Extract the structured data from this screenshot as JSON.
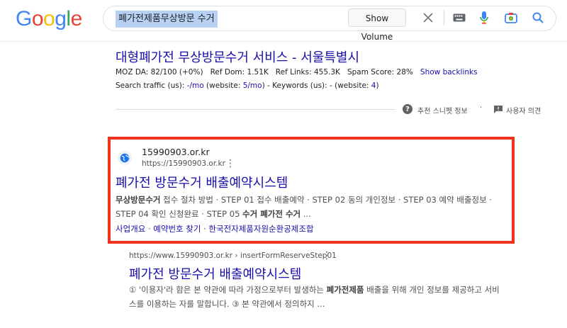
{
  "header": {
    "logo_letters": [
      {
        "ch": "G",
        "color": "#4285F4"
      },
      {
        "ch": "o",
        "color": "#EA4335"
      },
      {
        "ch": "o",
        "color": "#FBBC05"
      },
      {
        "ch": "g",
        "color": "#4285F4"
      },
      {
        "ch": "l",
        "color": "#34A853"
      },
      {
        "ch": "e",
        "color": "#EA4335"
      }
    ],
    "query": "폐가전제품무상방문 수거",
    "show_volume_label": "Show Volume",
    "icons": [
      "close-icon",
      "keyboard-icon",
      "mic-icon",
      "camera-icon",
      "search-icon"
    ]
  },
  "result1": {
    "title": "대형폐가전 무상방문수거 서비스 - 서울특별시",
    "moz_da": "MOZ DA: 82/100 (+0%)",
    "ref_dom": "Ref Dom: 1.51K",
    "ref_links": "Ref Links: 455.3K",
    "spam_score": "Spam Score: 28%",
    "show_backlinks": "Show backlinks",
    "traffic_prefix": "Search traffic (us): ",
    "traffic_value": "-/mo",
    "traffic_website_prefix": " (website: ",
    "traffic_website_value": "5/mo",
    "keywords_text": ") - Keywords (us): - (website: ",
    "keywords_value": "4",
    "keywords_suffix": ")"
  },
  "feedback": {
    "snippet_label": "추천 스니펫 정보",
    "separator": "·",
    "feedback_label": "사용자 의견"
  },
  "result2": {
    "site_name": "15990903.or.kr",
    "url": "https://15990903.or.kr",
    "title": "폐가전 방문수거 배출예약시스템",
    "snippet_line1": [
      {
        "t": "무상방문수거",
        "b": true
      },
      {
        "t": " 접수 절차 방법 · STEP 01 접수 배출예약 · STEP 02 동의 개인정보 · STEP 03 예약 배출정보 ·",
        "b": false
      }
    ],
    "snippet_line2": [
      {
        "t": "STEP 04 확인 신청완료 · STEP 05 ",
        "b": false
      },
      {
        "t": "수거 폐가전 수거",
        "b": true
      },
      {
        "t": " ...",
        "b": false
      }
    ],
    "sitelinks": [
      "사업개요",
      "예약번호 찾기",
      "한국전자제품자원순환공제조합"
    ],
    "sitelink_sep": " · "
  },
  "result3": {
    "url": "https://www.15990903.or.kr › insertFormReserveStep01",
    "title": "폐가전 방문수거 배출예약시스템",
    "snippet_line1": [
      {
        "t": "① '이용자'라 함은 본 약관에 따라 가정으로부터 발생하는 ",
        "b": false
      },
      {
        "t": "폐가전제품",
        "b": true
      },
      {
        "t": " 배출을 위해 개인 정보를 제공하고 서비",
        "b": false
      }
    ],
    "snippet_line2": [
      {
        "t": "스를 이용하는 자를 말합니다. ③ 본 약관에서 정의하지 ...",
        "b": false
      }
    ]
  },
  "colors": {
    "link": "#1a0dab",
    "highlight_border": "#f0321f",
    "query_highlight": "#b7d1f5"
  }
}
